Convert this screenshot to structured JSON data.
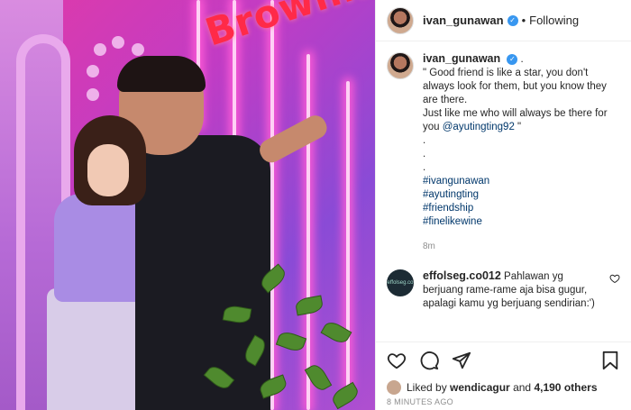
{
  "header": {
    "username": "ivan_gunawan",
    "separator": "•",
    "follow_status": "Following"
  },
  "photo": {
    "sign_text": "Brownis"
  },
  "caption": {
    "username": "ivan_gunawan",
    "username_suffix": ".",
    "line1": "\" Good friend is like a star, you don't always look for them, but you know they are there.",
    "line2": "Just like me who will always be there for you",
    "mention": "@ayutingting92",
    "line2_end": " \"",
    "dots": [
      ".",
      ".",
      "."
    ],
    "hashtags": [
      "#ivangunawan",
      "#ayutingting",
      "#friendship",
      "#finelikewine"
    ],
    "time": "8m"
  },
  "comment": {
    "username": "effolseg.co012",
    "text": "Pahlawan yg berjuang rame-rame aja bisa gugur, apalagi kamu yg berjuang sendirian:')",
    "avatar_text": "effolseg.co"
  },
  "likes": {
    "prefix": "Liked by",
    "user": "wendicagur",
    "conjunction": "and",
    "others": "4,190 others"
  },
  "timestamp": "8 MINUTES AGO",
  "icons": {
    "verified": "verified-badge-icon",
    "like": "heart-icon",
    "comment": "comment-bubble-icon",
    "share": "paper-plane-icon",
    "save": "bookmark-icon"
  },
  "colors": {
    "link": "#00376b",
    "verified": "#3897f0",
    "muted": "#8e8e8e"
  }
}
